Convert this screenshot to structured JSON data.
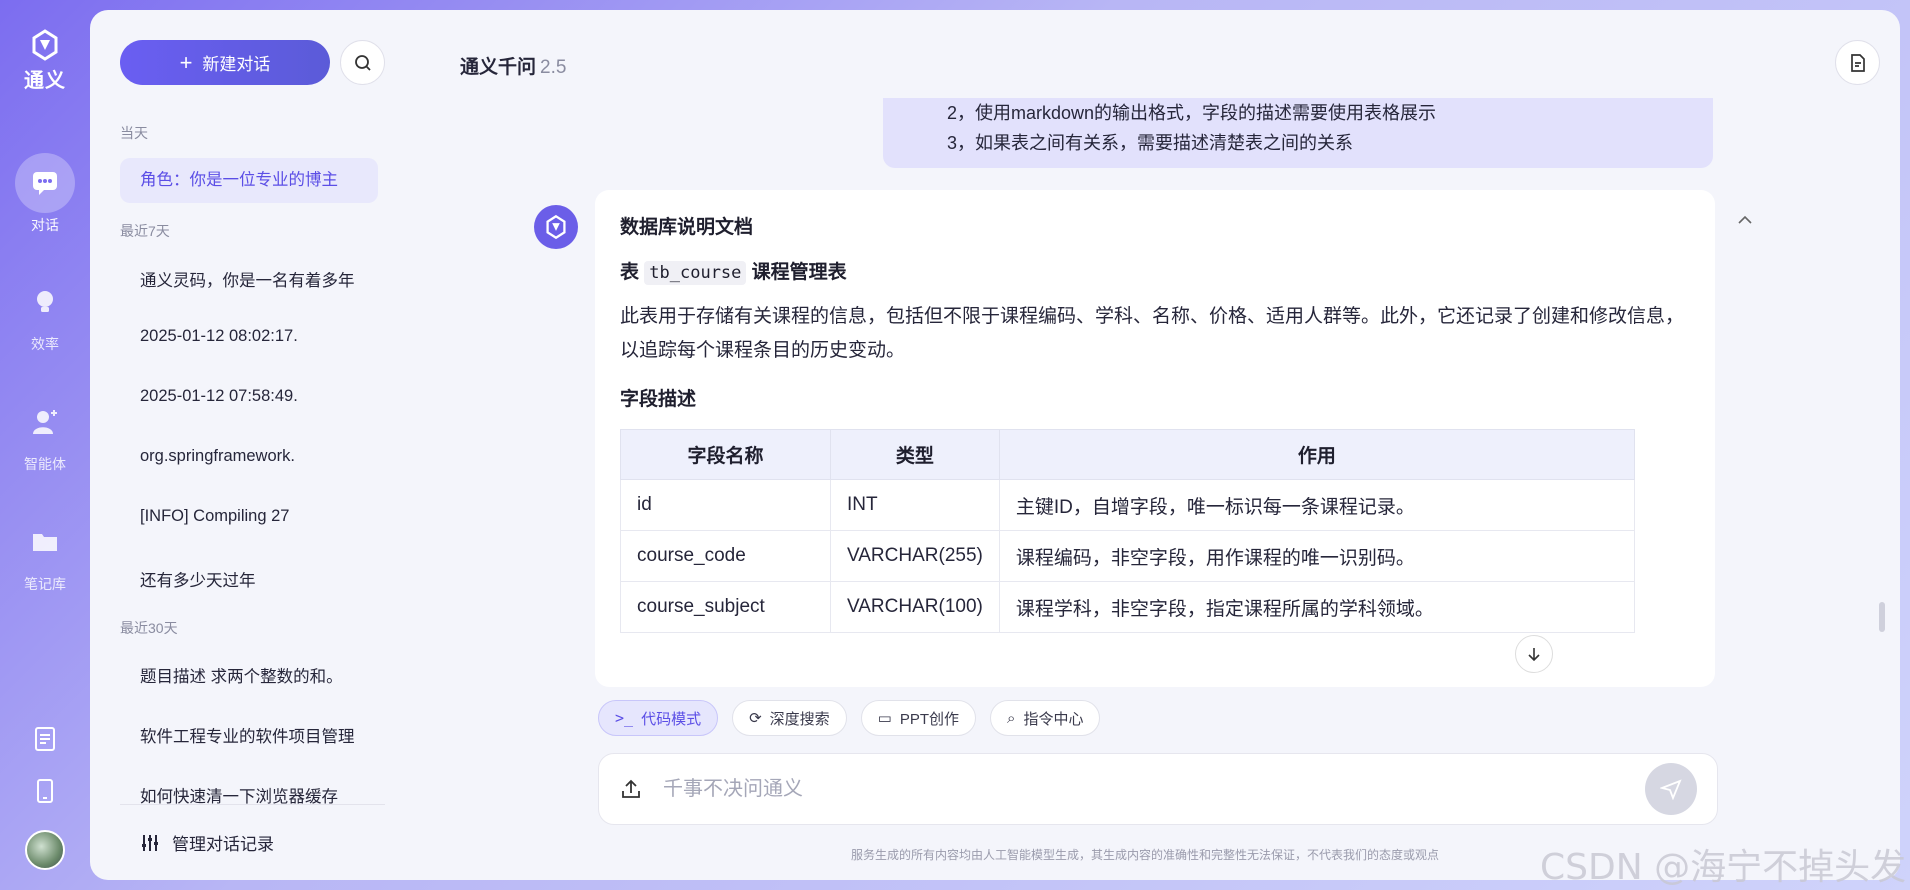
{
  "rail": {
    "logo_label": "通义",
    "items": [
      {
        "label": "对话",
        "icon": "chat-icon",
        "active": true
      },
      {
        "label": "效率",
        "icon": "lightbulb-icon"
      },
      {
        "label": "智能体",
        "icon": "agent-icon"
      },
      {
        "label": "笔记库",
        "icon": "folder-icon"
      }
    ]
  },
  "sidebar": {
    "new_chat_label": "新建对话",
    "sections": [
      {
        "title": "当天",
        "items": [
          "角色：你是一位专业的博主"
        ]
      },
      {
        "title": "最近7天",
        "items": [
          "通义灵码，你是一名有着多年",
          "2025-01-12 08:02:17.",
          "2025-01-12 07:58:49.",
          "org.springframework.",
          "[INFO] Compiling 27",
          "还有多少天过年"
        ]
      },
      {
        "title": "最近30天",
        "items": [
          "题目描述 求两个整数的和。",
          "软件工程专业的软件项目管理",
          "如何快速清一下浏览器缓存"
        ]
      }
    ],
    "manage_label": "管理对话记录"
  },
  "header": {
    "title": "通义千问",
    "version": "2.5"
  },
  "user_message": {
    "lines": [
      "2，使用markdown的输出格式，字段的描述需要使用表格展示",
      "3，如果表之间有关系，需要描述清楚表之间的关系"
    ]
  },
  "answer": {
    "heading": "数据库说明文档",
    "table_prefix": "表 ",
    "table_code": "tb_course",
    "table_suffix": " 课程管理表",
    "description": "此表用于存储有关课程的信息，包括但不限于课程编码、学科、名称、价格、适用人群等。此外，它还记录了创建和修改信息，以追踪每个课程条目的历史变动。",
    "fields_heading": "字段描述",
    "columns": [
      "字段名称",
      "类型",
      "作用"
    ],
    "rows": [
      [
        "id",
        "INT",
        "主键ID，自增字段，唯一标识每一条课程记录。"
      ],
      [
        "course_code",
        "VARCHAR(255)",
        "课程编码，非空字段，用作课程的唯一识别码。"
      ],
      [
        "course_subject",
        "VARCHAR(100)",
        "课程学科，非空字段，指定课程所属的学科领域。"
      ]
    ]
  },
  "chips": [
    {
      "label": "代码模式",
      "icon": "terminal-icon",
      "active": true
    },
    {
      "label": "深度搜索",
      "icon": "deep-search-icon"
    },
    {
      "label": "PPT创作",
      "icon": "presentation-icon"
    },
    {
      "label": "指令中心",
      "icon": "command-icon"
    }
  ],
  "input": {
    "placeholder": "千事不决问通义",
    "value": ""
  },
  "disclaimer": "服务生成的所有内容均由人工智能模型生成，其生成内容的准确性和完整性无法保证，不代表我们的态度或观点",
  "watermark": "CSDN @海宁不掉头发",
  "colors": {
    "accent": "#5b4ee6",
    "rail_gradient_start": "#7c6df0"
  }
}
